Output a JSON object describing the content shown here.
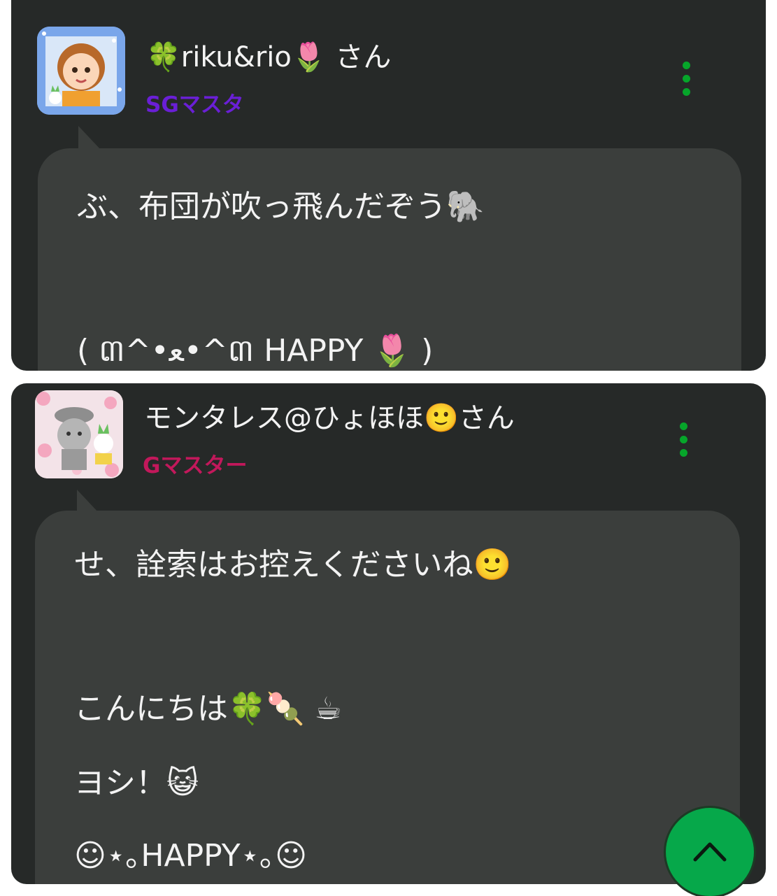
{
  "posts": [
    {
      "username": "🍀riku&rio🌷 さん",
      "rank": "SGマスタ",
      "rank_color": "#6a1fd6",
      "lines": [
        "ぶ、布団が吹っ飛んだぞう🐘",
        "( ៣^•ﻌ•^៣ HAPPY 🌷 )"
      ]
    },
    {
      "username": "モンタレス@ひょほほ🙂さん",
      "rank": "Gマスター",
      "rank_color": "#c2185b",
      "lines": [
        "せ、詮索はお控えくださいね🙂",
        "こんにちは🍀🍡 ☕",
        "ヨシ！😺",
        "☺⋆｡HAPPY⋆｡☺"
      ]
    }
  ],
  "colors": {
    "card_bg": "#262928",
    "bubble_bg": "#3b3e3c",
    "accent_green": "#06a52a"
  },
  "icons": {
    "menu": "kebab-menu-icon",
    "scroll_top": "chevron-up-icon"
  }
}
